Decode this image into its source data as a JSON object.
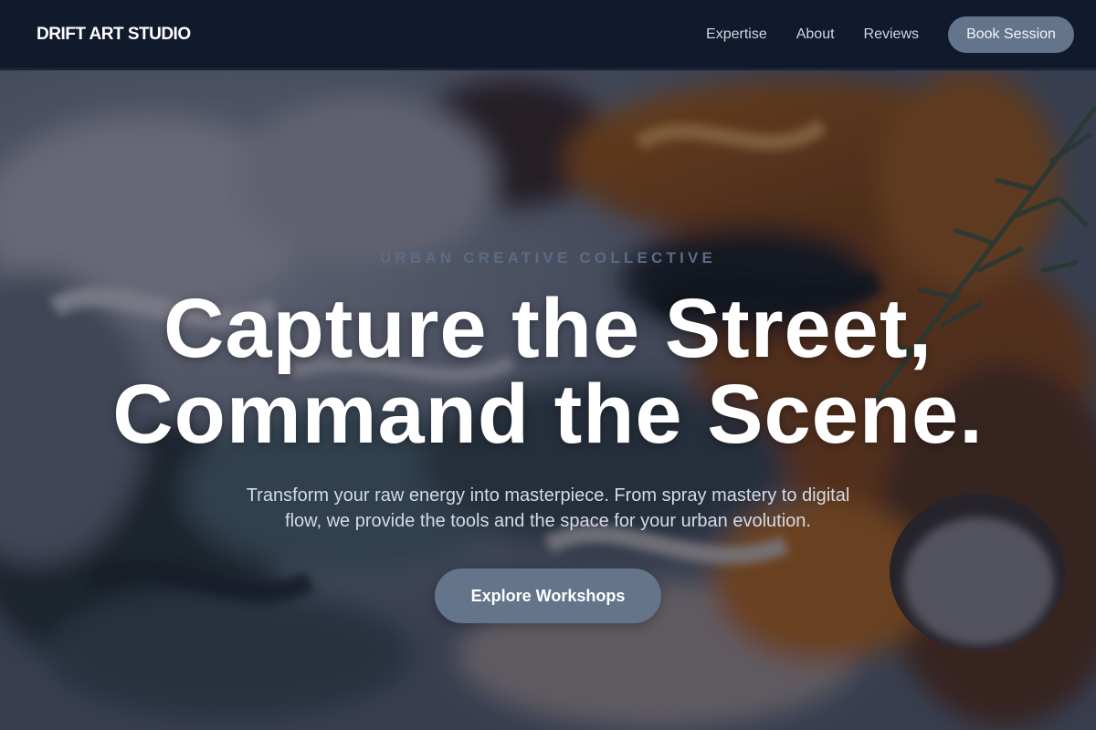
{
  "header": {
    "brand": "DRIFT ART STUDIO",
    "nav": [
      {
        "label": "Expertise"
      },
      {
        "label": "About"
      },
      {
        "label": "Reviews"
      }
    ],
    "book_label": "Book Session"
  },
  "hero": {
    "eyebrow": "URBAN CREATIVE COLLECTIVE",
    "headline_line1": "Capture the Street,",
    "headline_line2": "Command the Scene.",
    "subtext": "Transform your raw energy into masterpiece. From spray mastery to digital flow, we provide the tools and the space for your urban evolution.",
    "cta_label": "Explore Workshops",
    "background_icon": "oil-paint-texture-image"
  },
  "colors": {
    "header_bg": "#111a2c",
    "button_bg": "#64748b",
    "eyebrow": "#5c6b85",
    "headline": "#ffffff"
  }
}
